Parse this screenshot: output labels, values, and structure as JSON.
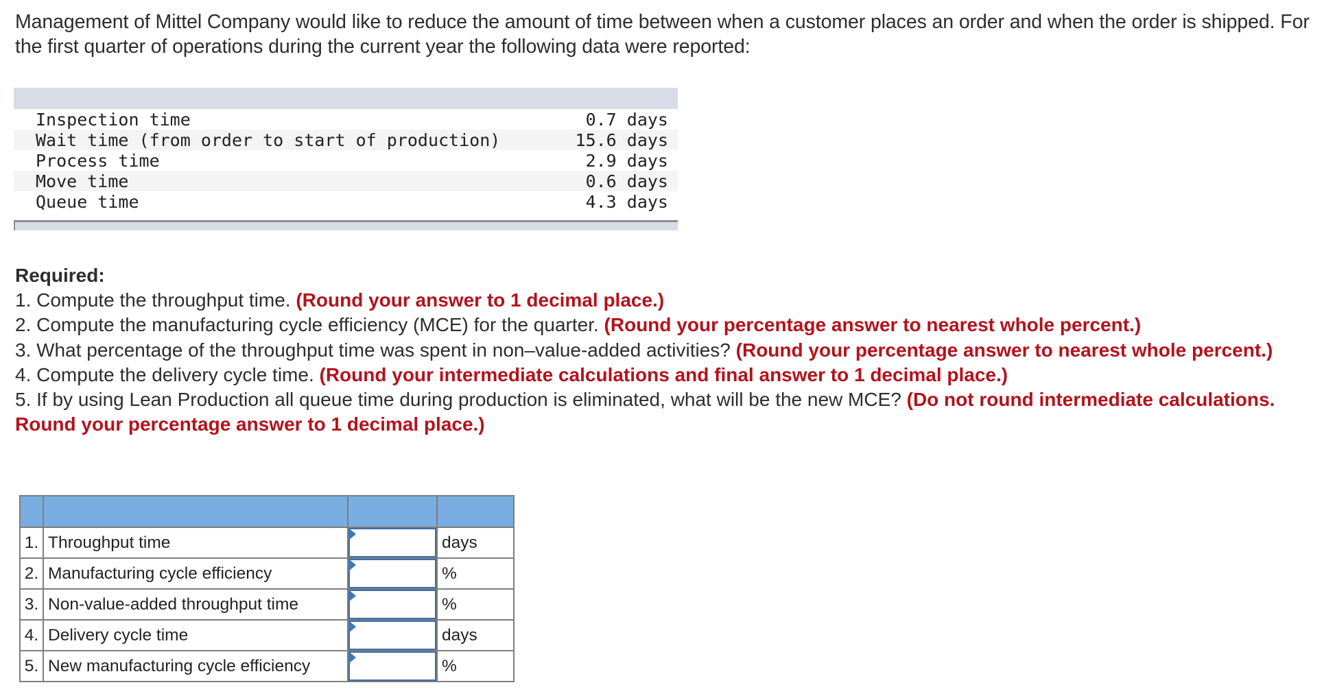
{
  "intro": {
    "text": "Management of Mittel Company would like to reduce the amount of time between when a customer places an order and when the order is shipped. For the first quarter of operations during the current year the following data were reported:"
  },
  "data_table": {
    "rows": [
      {
        "label": "Inspection time",
        "value": "0.7 days"
      },
      {
        "label": "Wait time (from order to start of production)",
        "value": "15.6 days"
      },
      {
        "label": "Process time",
        "value": "2.9 days"
      },
      {
        "label": "Move time",
        "value": "0.6 days"
      },
      {
        "label": "Queue time",
        "value": "4.3 days"
      }
    ]
  },
  "required": {
    "title": "Required:",
    "items": [
      {
        "text": "1. Compute the throughput time. ",
        "note": "(Round your answer to 1 decimal place.)"
      },
      {
        "text": "2. Compute the manufacturing cycle efficiency (MCE) for the quarter. ",
        "note": "(Round your percentage answer to nearest whole percent.)"
      },
      {
        "text": "3. What percentage of the throughput time was spent in non–value-added activities? ",
        "note": "(Round your percentage answer to nearest whole percent.)"
      },
      {
        "text": "4. Compute the delivery cycle time. ",
        "note": "(Round your intermediate calculations and final answer to 1 decimal place.)"
      },
      {
        "text": "5. If by using Lean Production all queue time during production is eliminated, what will be the new MCE? ",
        "note": "(Do not round intermediate calculations. Round your percentage answer to 1 decimal place.)"
      }
    ]
  },
  "answer_table": {
    "header_color": "#79ade1",
    "rows": [
      {
        "num": "1.",
        "label": "Throughput time",
        "value": "",
        "unit": "days"
      },
      {
        "num": "2.",
        "label": "Manufacturing cycle efficiency",
        "value": "",
        "unit": "%"
      },
      {
        "num": "3.",
        "label": "Non-value-added throughput time",
        "value": "",
        "unit": "%"
      },
      {
        "num": "4.",
        "label": "Delivery cycle time",
        "value": "",
        "unit": "days"
      },
      {
        "num": "5.",
        "label": "New manufacturing cycle efficiency",
        "value": "",
        "unit": "%"
      }
    ]
  },
  "colors": {
    "note_red": "#b5121b",
    "input_border": "#3d6ea8",
    "data_band": "#d8dce6"
  }
}
